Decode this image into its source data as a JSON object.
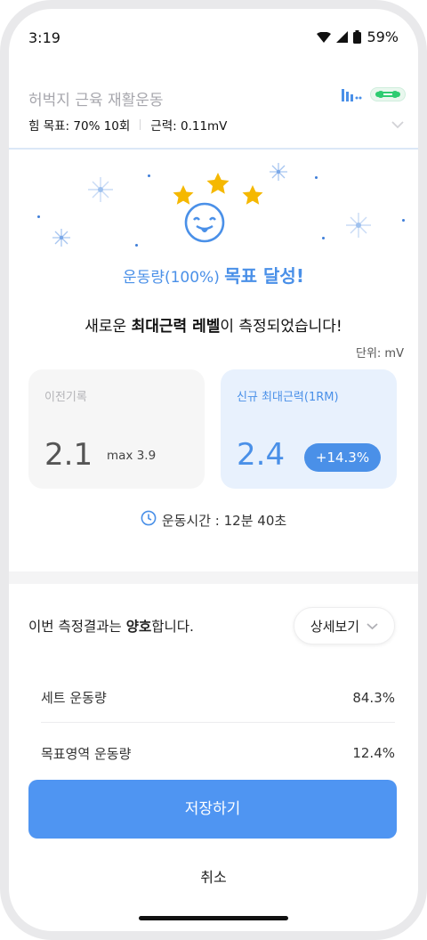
{
  "status_bar": {
    "time": "3:19",
    "battery": "59%"
  },
  "header": {
    "title": "허벅지 근육 재활운동",
    "goal": "힘 목표: 70% 10회",
    "strength": "근력: 0.11mV"
  },
  "celebration": {
    "stars": 3,
    "achieve_prefix": "운동량(100%)",
    "achieve_main": "목표 달성!"
  },
  "new_level": {
    "part1": "새로운 ",
    "bold": "최대근력 레벨",
    "part2": "이 측정되었습니다!"
  },
  "unit": "단위: mV",
  "cards": {
    "previous": {
      "label": "이전기록",
      "value": "2.1",
      "max": "max 3.9"
    },
    "new": {
      "label": "신규 최대근력(1RM)",
      "value": "2.4",
      "badge": "+14.3%"
    }
  },
  "exercise_time": "운동시간 : 12분 40초",
  "result": {
    "prefix": "이번 측정결과는 ",
    "bold": "양호",
    "suffix": "합니다."
  },
  "detail_button": "상세보기",
  "rows": [
    {
      "label": "세트 운동량",
      "value": "84.3%"
    },
    {
      "label": "목표영역 운동량",
      "value": "12.4%"
    }
  ],
  "save_button": "저장하기",
  "cancel_button": "취소",
  "colors": {
    "accent": "#4a90e8",
    "star": "#f5b800",
    "button": "#4f95f2",
    "device_green": "#2ecc71"
  }
}
